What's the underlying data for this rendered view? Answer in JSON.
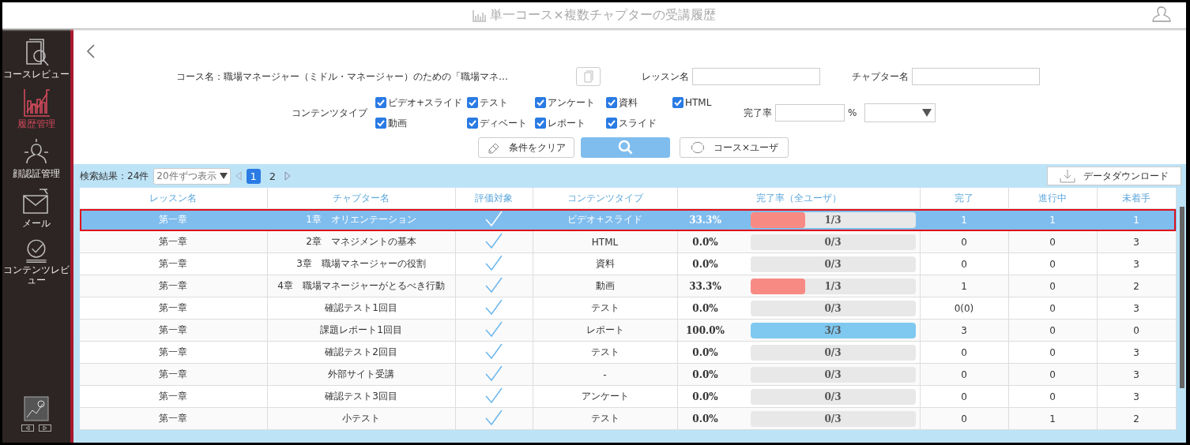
{
  "header": {
    "title": "単一コース×複数チャプターの受講履歴"
  },
  "sidebar": {
    "items": [
      {
        "label": "コースレビュー",
        "selected": false
      },
      {
        "label": "履歴管理",
        "selected": true
      },
      {
        "label": "顔認証管理",
        "selected": false
      },
      {
        "label": "メール",
        "selected": false
      },
      {
        "label": "コンテンツレビュー",
        "selected": false
      }
    ]
  },
  "filters": {
    "course_label": "コース名：職場マネージャー（ミドル・マネージャー）のための「職場マネ…",
    "lesson_label": "レッスン名",
    "chapter_label": "チャプター名",
    "content_type_label": "コンテンツタイプ",
    "content_types": [
      {
        "label": "ビデオ+スライド",
        "checked": true
      },
      {
        "label": "テスト",
        "checked": true
      },
      {
        "label": "アンケート",
        "checked": true
      },
      {
        "label": "資料",
        "checked": true
      },
      {
        "label": "HTML",
        "checked": true
      },
      {
        "label": "動画",
        "checked": true
      },
      {
        "label": "ディベート",
        "checked": true
      },
      {
        "label": "レポート",
        "checked": true
      },
      {
        "label": "スライド",
        "checked": true
      }
    ],
    "rate_label": "完了率",
    "rate_unit": "%"
  },
  "buttons": {
    "clear": "条件をクリア",
    "switch": "コース×ユーザ"
  },
  "results": {
    "summary": "検索結果：24件",
    "page_size": "20件ずつ表示",
    "pages": [
      {
        "label": "1",
        "selected": true
      },
      {
        "label": "2",
        "selected": false
      }
    ],
    "download": "データダウンロード"
  },
  "table": {
    "columns": [
      "レッスン名",
      "チャプター名",
      "評価対象",
      "コンテンツタイプ",
      "完了率（全ユーザ）",
      "完了",
      "進行中",
      "未着手"
    ],
    "rows": [
      {
        "lesson": "第一章",
        "chapter": "1章　オリエンテーション",
        "evaluated": true,
        "type": "ビデオ+スライド",
        "rate": "33.3%",
        "level": 0.333,
        "fraction": "1/3",
        "done": "1",
        "in_progress": "1",
        "not_started": "1",
        "selected": true
      },
      {
        "lesson": "第一章",
        "chapter": "2章　マネジメントの基本",
        "evaluated": true,
        "type": "HTML",
        "rate": "0.0%",
        "fraction": "0/3",
        "done": "0",
        "in_progress": "0",
        "not_started": "3",
        "selected": false
      },
      {
        "lesson": "第一章",
        "chapter": "3章　職場マネージャーの役割",
        "evaluated": true,
        "type": "資料",
        "rate": "0.0%",
        "fraction": "0/3",
        "done": "0",
        "in_progress": "0",
        "not_started": "3",
        "selected": false
      },
      {
        "lesson": "第一章",
        "chapter": "4章　職場マネージャーがとるべき行動",
        "evaluated": true,
        "type": "動画",
        "rate": "33.3%",
        "level": 0.333,
        "fraction": "1/3",
        "done": "1",
        "in_progress": "0",
        "not_started": "2",
        "selected": false
      },
      {
        "lesson": "第一章",
        "chapter": "確認テスト1回目",
        "evaluated": true,
        "type": "テスト",
        "rate": "0.0%",
        "fraction": "0/3",
        "done": "0(0)",
        "in_progress": "0",
        "not_started": "3",
        "selected": false
      },
      {
        "lesson": "第一章",
        "chapter": "課題レポート1回目",
        "evaluated": true,
        "type": "レポート",
        "rate": "100.0%",
        "level": 1,
        "fraction": "3/3",
        "done": "3",
        "in_progress": "0",
        "not_started": "0",
        "selected": false
      },
      {
        "lesson": "第一章",
        "chapter": "確認テスト2回目",
        "evaluated": true,
        "type": "テスト",
        "rate": "0.0%",
        "fraction": "0/3",
        "done": "0",
        "in_progress": "0",
        "not_started": "3",
        "selected": false
      },
      {
        "lesson": "第一章",
        "chapter": "外部サイト受講",
        "evaluated": true,
        "type": "-",
        "rate": "0.0%",
        "fraction": "0/3",
        "done": "0",
        "in_progress": "0",
        "not_started": "3",
        "selected": false
      },
      {
        "lesson": "第一章",
        "chapter": "確認テスト3回目",
        "evaluated": true,
        "type": "アンケート",
        "rate": "0.0%",
        "fraction": "0/3",
        "done": "0",
        "in_progress": "0",
        "not_started": "3",
        "selected": false
      },
      {
        "lesson": "第一章",
        "chapter": "小テスト",
        "evaluated": true,
        "type": "テスト",
        "rate": "0.0%",
        "fraction": "0/3",
        "done": "0",
        "in_progress": "1",
        "not_started": "2",
        "selected": false
      }
    ]
  }
}
